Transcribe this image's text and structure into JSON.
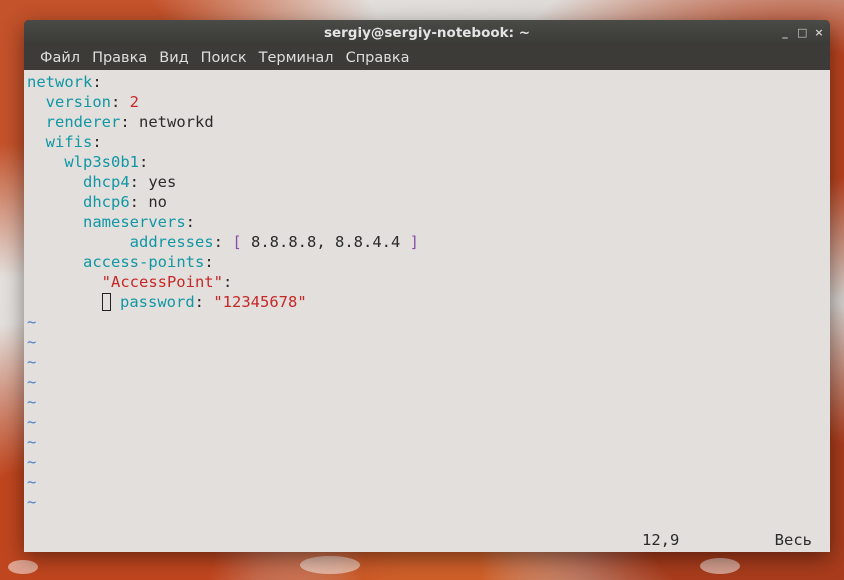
{
  "window": {
    "title": "sergiy@sergiy-notebook: ~",
    "controls": {
      "minimize": "_",
      "maximize": "□",
      "close": "×"
    }
  },
  "menu": [
    "Файл",
    "Правка",
    "Вид",
    "Поиск",
    "Терминал",
    "Справка"
  ],
  "editor": {
    "lines": {
      "l1_key": "network",
      "l2_key": "version",
      "l2_val": "2",
      "l3_key": "renderer",
      "l3_val": "networkd",
      "l4_key": "wifis",
      "l5_key": "wlp3s0b1",
      "l6_key": "dhcp4",
      "l6_val": "yes",
      "l7_key": "dhcp6",
      "l7_val": "no",
      "l8_key": "nameservers",
      "l9_key": "addresses",
      "l9_open": "[",
      "l9_val": "8.8.8.8, 8.8.4.4",
      "l9_close": "]",
      "l10_key": "access-points",
      "l11_str": "\"AccessPoint\"",
      "l12_key": "password",
      "l12_str": "\"12345678\""
    },
    "empty_line_marker": "~",
    "status": {
      "position": "12,9",
      "scope": "Весь"
    }
  },
  "colors": {
    "key": "#1197a5",
    "string": "#c62828",
    "number": "#c62828",
    "bracket": "#8a4fa6",
    "tilde": "#4a7fc9"
  }
}
